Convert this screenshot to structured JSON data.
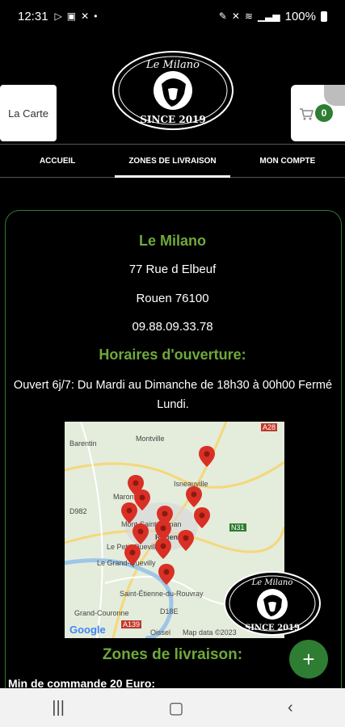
{
  "status": {
    "time": "12:31",
    "battery": "100%"
  },
  "header": {
    "carte_label": "La Carte",
    "cart_count": "0",
    "logo_name": "Le Milano",
    "logo_since": "SINCE 2019"
  },
  "tabs": [
    {
      "label": "ACCUEIL"
    },
    {
      "label": "ZONES DE LIVRAISON"
    },
    {
      "label": "MON COMPTE"
    }
  ],
  "restaurant": {
    "name": "Le Milano",
    "street": "77 Rue d Elbeuf",
    "city": "Rouen 76100",
    "phone": "09.88.09.33.78",
    "hours_title": "Horaires d'ouverture:",
    "hours_text": "Ouvert 6j/7: Du Mardi au Dimanche de 18h30 à 00h00 Fermé Lundi."
  },
  "map": {
    "labels": [
      "Barentin",
      "Montville",
      "A28",
      "Isneauville",
      "D982",
      "Marome",
      "Mont-Saint-Aignan",
      "N31",
      "Rouen",
      "Le Petit-Quevilly",
      "Le Grand-Quevilly",
      "Saint-Étienne-du-Rouvray",
      "Grand-Couronne",
      "D18E",
      "A139",
      "Oissel",
      "Map data ©2023",
      "Google"
    ]
  },
  "delivery": {
    "title": "Zones de livraison:",
    "min_order": "Min de commande 20 Euro:"
  },
  "colors": {
    "accent_green": "#6fa93a",
    "badge_green": "#2e7d32"
  }
}
